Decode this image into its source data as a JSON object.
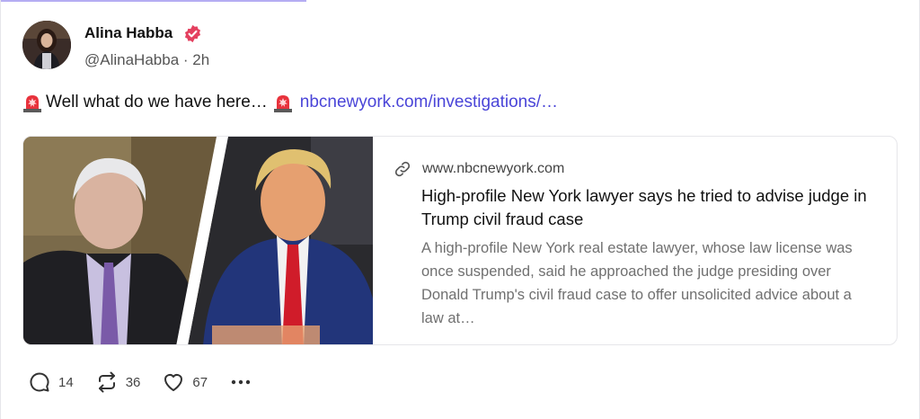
{
  "author": {
    "name": "Alina Habba",
    "handle": "@AlinaHabba",
    "separator": "·",
    "time": "2h"
  },
  "post": {
    "text": "Well what do we have here…",
    "link_text": "nbcnewyork.com/investigations/…"
  },
  "card": {
    "domain": "www.nbcnewyork.com",
    "title": "High-profile New York lawyer says he tried to advise judge in Trump civil fraud case",
    "description": "A high-profile New York real estate lawyer, whose law license was once suspended, said he approached the judge presiding over Donald Trump's civil fraud case to offer unsolicited advice about a law at…"
  },
  "actions": {
    "replies": "14",
    "reposts": "36",
    "likes": "67"
  },
  "icons": {
    "verified": "verified-badge-icon",
    "siren": "police-siren-icon",
    "link": "link-icon",
    "reply": "reply-bubble-icon",
    "repost": "repost-icon",
    "like": "heart-icon",
    "more": "more-dots-icon"
  },
  "colors": {
    "verified": "#e4405f",
    "link": "#4a45d8",
    "muted_text": "#707070"
  }
}
